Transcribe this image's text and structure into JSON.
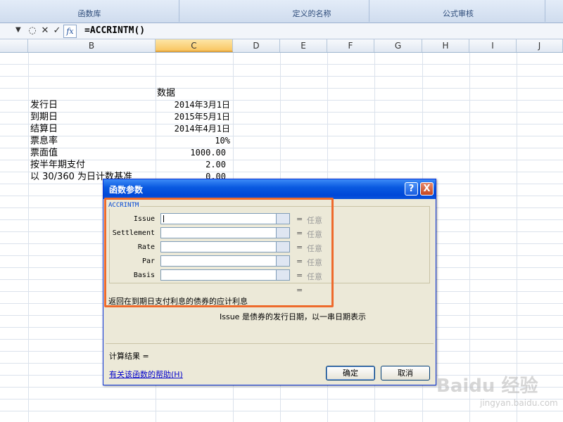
{
  "ribbon": {
    "groups": [
      {
        "label": "函数库"
      },
      {
        "label": "定义的名称"
      },
      {
        "label": "公式审核"
      }
    ]
  },
  "formula_bar": {
    "formula": "=ACCRINTM()"
  },
  "columns": [
    "B",
    "C",
    "D",
    "E",
    "F",
    "G",
    "H",
    "I",
    "J"
  ],
  "sheet": {
    "header": "数据",
    "rows": [
      {
        "label": "发行日",
        "value": "2014年3月1日"
      },
      {
        "label": "到期日",
        "value": "2015年5月1日"
      },
      {
        "label": "结算日",
        "value": "2014年4月1日"
      },
      {
        "label": "票息率",
        "value": "10%"
      },
      {
        "label": "票面值",
        "value": "1000.00"
      },
      {
        "label": "按半年期支付",
        "value": "2.00"
      },
      {
        "label": "以 30/360 为日计数基准",
        "value": "0.00"
      }
    ]
  },
  "dialog": {
    "title": "函数参数",
    "function_name": "ACCRINTM",
    "args": [
      {
        "name": "Issue",
        "eq": "=",
        "hint": "任意"
      },
      {
        "name": "Settlement",
        "eq": "=",
        "hint": "任意"
      },
      {
        "name": "Rate",
        "eq": "=",
        "hint": "任意"
      },
      {
        "name": "Par",
        "eq": "=",
        "hint": "任意"
      },
      {
        "name": "Basis",
        "eq": "=",
        "hint": "任意"
      }
    ],
    "total_eq": "=",
    "description": "返回在到期日支付利息的债券的应计利息",
    "arg_description": "Issue  是债券的发行日期，以一串日期表示",
    "result_label": "计算结果 =",
    "help_link": "有关该函数的帮助(H)",
    "ok_label": "确定",
    "cancel_label": "取消",
    "help_button": "?",
    "close_button": "X"
  },
  "watermark": {
    "text": "Baidu 经验",
    "sub": "jingyan.baidu.com"
  }
}
